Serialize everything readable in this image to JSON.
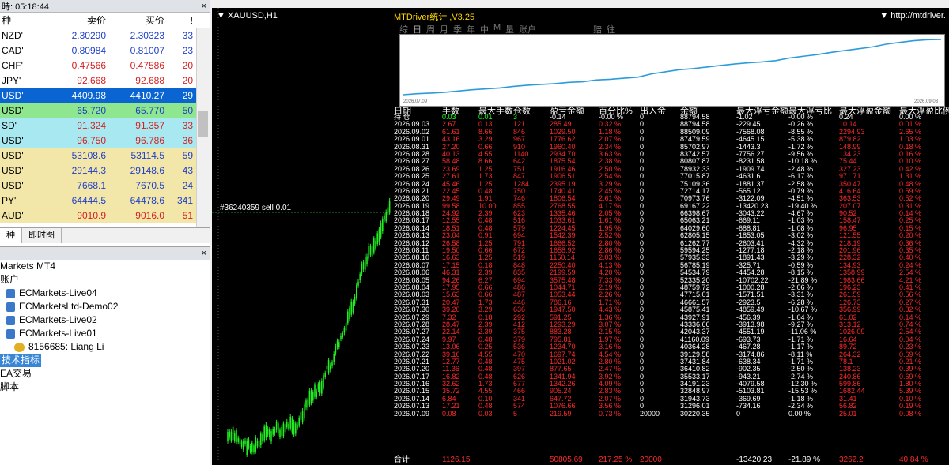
{
  "market_watch": {
    "time_label": "時: 05:18:44",
    "headers": [
      "种",
      "卖价",
      "买价",
      "!"
    ],
    "rows": [
      {
        "sym": "NZD'",
        "bid": "2.30290",
        "ask": "2.30323",
        "spread": "33",
        "bg": "#ffffff",
        "fg": "#1f3fc9"
      },
      {
        "sym": "CAD'",
        "bid": "0.80984",
        "ask": "0.81007",
        "spread": "23",
        "bg": "#ffffff",
        "fg": "#1f3fc9"
      },
      {
        "sym": "CHF'",
        "bid": "0.47566",
        "ask": "0.47586",
        "spread": "20",
        "bg": "#ffffff",
        "fg": "#d42020"
      },
      {
        "sym": "JPY'",
        "bid": "92.668",
        "ask": "92.688",
        "spread": "20",
        "bg": "#ffffff",
        "fg": "#d42020"
      },
      {
        "sym": "USD'",
        "bid": "4409.98",
        "ask": "4410.27",
        "spread": "29",
        "bg": "#0a64d2",
        "fg": "#ffffff"
      },
      {
        "sym": "USD'",
        "bid": "65.720",
        "ask": "65.770",
        "spread": "50",
        "bg": "#8ee68e",
        "fg": "#1f3fc9"
      },
      {
        "sym": "SD'",
        "bid": "91.324",
        "ask": "91.357",
        "spread": "33",
        "bg": "#a8e8f0",
        "fg": "#d42020"
      },
      {
        "sym": "USD'",
        "bid": "96.750",
        "ask": "96.786",
        "spread": "36",
        "bg": "#a8e8f0",
        "fg": "#d42020"
      },
      {
        "sym": "USD'",
        "bid": "53108.6",
        "ask": "53114.5",
        "spread": "59",
        "bg": "#f2e6a8",
        "fg": "#1f3fc9"
      },
      {
        "sym": "USD'",
        "bid": "29144.3",
        "ask": "29148.6",
        "spread": "43",
        "bg": "#f2e6a8",
        "fg": "#1f3fc9"
      },
      {
        "sym": "USD'",
        "bid": "7668.1",
        "ask": "7670.5",
        "spread": "24",
        "bg": "#f2e6a8",
        "fg": "#1f3fc9"
      },
      {
        "sym": "PY'",
        "bid": "64444.5",
        "ask": "64478.6",
        "spread": "341",
        "bg": "#f2e6a8",
        "fg": "#1f3fc9"
      },
      {
        "sym": "AUD'",
        "bid": "9010.9",
        "ask": "9016.0",
        "spread": "51",
        "bg": "#f2e6a8",
        "fg": "#d42020"
      }
    ],
    "tabs": [
      "种",
      "即时图"
    ]
  },
  "navigator": {
    "items": [
      {
        "text": "Markets MT4",
        "indent": 0,
        "icon": ""
      },
      {
        "text": "账户",
        "indent": 0,
        "icon": ""
      },
      {
        "text": "ECMarkets-Live04",
        "indent": 8,
        "icon": "server"
      },
      {
        "text": "ECMarketsLtd-Demo02",
        "indent": 8,
        "icon": "server"
      },
      {
        "text": "ECMarkets-Live02",
        "indent": 8,
        "icon": "server"
      },
      {
        "text": "ECMarkets-Live01",
        "indent": 8,
        "icon": "server"
      },
      {
        "text": "8156685: Liang Li",
        "indent": 18,
        "icon": "user"
      },
      {
        "text": "技术指标",
        "indent": 0,
        "icon": "",
        "selected": true
      },
      {
        "text": "EA交易",
        "indent": 0,
        "icon": ""
      },
      {
        "text": "脚本",
        "indent": 0,
        "icon": ""
      }
    ]
  },
  "chart": {
    "title": "XAUUSD,H1",
    "label": "#36240359 sell 0.01"
  },
  "panel": {
    "title": "MTDriver统计 ,V3.25",
    "url": "http://mtdriver.",
    "tabs": [
      "综",
      "日",
      "周",
      "月",
      "季",
      "年",
      "中",
      "M",
      "量",
      "账户",
      "",
      "赔",
      "往"
    ],
    "eq_start": "2026.07.09",
    "eq_end": "2026.09.03",
    "headers": [
      "日期",
      "手数",
      "最大手数",
      "仓数",
      "盈亏金额",
      "百分比%",
      "出入金",
      "余额",
      "最大浮亏金额",
      "最大浮亏比",
      "最大浮盈金额",
      "最大浮盈比例"
    ],
    "hold": {
      "date": "持 仓",
      "lots": "0.03",
      "maxlots": "0.01",
      "cnt": "3",
      "pnl": "-0.14",
      "pct": "-0.00 %",
      "io": "0",
      "bal": "88794.58",
      "fl": "-1.02",
      "flp": "-0.00 %",
      "fp": "0.24",
      "fpp": "0.00 %"
    },
    "rows": [
      [
        "2026.09.03",
        "2.67",
        "0.13",
        "121",
        "285.49",
        "0.32 %",
        "0",
        "88794.58",
        "-229.45",
        "-0.26 %",
        "10.14",
        "0.01 %"
      ],
      [
        "2026.09.02",
        "61.61",
        "8.66",
        "846",
        "1029.50",
        "1.18 %",
        "0",
        "88509.09",
        "-7568.08",
        "-8.55 %",
        "2294.93",
        "2.65 %"
      ],
      [
        "2026.09.01",
        "43.16",
        "3.29",
        "967",
        "1776.62",
        "2.07 %",
        "0",
        "87479.59",
        "-4645.15",
        "-5.38 %",
        "879.82",
        "1.03 %"
      ],
      [
        "2026.08.31",
        "27.20",
        "0.66",
        "910",
        "1960.40",
        "2.34 %",
        "0",
        "85702.97",
        "-1443.3",
        "-1.72 %",
        "148.99",
        "0.18 %"
      ],
      [
        "2026.08.28",
        "40.13",
        "4.55",
        "1140",
        "2934.70",
        "3.63 %",
        "0",
        "83742.57",
        "-7756.27",
        "-9.56 %",
        "134.23",
        "0.16 %"
      ],
      [
        "2026.08.27",
        "58.48",
        "8.66",
        "642",
        "1875.54",
        "2.38 %",
        "0",
        "80807.87",
        "-8231.58",
        "-10.18 %",
        "75.44",
        "0.10 %"
      ],
      [
        "2026.08.26",
        "23.69",
        "1.25",
        "751",
        "1916.46",
        "2.50 %",
        "0",
        "78932.33",
        "-1909.74",
        "-2.48 %",
        "327.23",
        "0.42 %"
      ],
      [
        "2026.08.25",
        "27.61",
        "1.73",
        "847",
        "1906.51",
        "2.54 %",
        "0",
        "77015.87",
        "-4631.6",
        "-6.17 %",
        "971.71",
        "1.31 %"
      ],
      [
        "2026.08.24",
        "45.46",
        "1.25",
        "1284",
        "2395.19",
        "3.29 %",
        "0",
        "75109.36",
        "-1881.37",
        "-2.58 %",
        "350.47",
        "0.48 %"
      ],
      [
        "2026.08.21",
        "22.45",
        "0.48",
        "750",
        "1740.41",
        "2.45 %",
        "0",
        "72714.17",
        "-565.12",
        "-0.79 %",
        "416.64",
        "0.59 %"
      ],
      [
        "2026.08.20",
        "29.49",
        "1.91",
        "746",
        "1806.54",
        "2.61 %",
        "0",
        "70973.76",
        "-3122.09",
        "-4.51 %",
        "363.53",
        "0.52 %"
      ],
      [
        "2026.08.19",
        "99.58",
        "10.00",
        "855",
        "2768.55",
        "4.17 %",
        "0",
        "69167.22",
        "-13420.23",
        "-19.40 %",
        "207.07",
        "0.31 %"
      ],
      [
        "2026.08.18",
        "24.92",
        "2.39",
        "623",
        "1335.46",
        "2.05 %",
        "0",
        "66398.67",
        "-3043.22",
        "-4.67 %",
        "90.52",
        "0.14 %"
      ],
      [
        "2026.08.17",
        "12.55",
        "0.48",
        "516",
        "1033.61",
        "1.61 %",
        "0",
        "65063.21",
        "-669.11",
        "-1.03 %",
        "158.47",
        "0.25 %"
      ],
      [
        "2026.08.14",
        "18.51",
        "0.48",
        "579",
        "1224.45",
        "1.95 %",
        "0",
        "64029.60",
        "-688.81",
        "-1.08 %",
        "96.95",
        "0.15 %"
      ],
      [
        "2026.08.13",
        "23.04",
        "0.91",
        "694",
        "1542.39",
        "2.52 %",
        "0",
        "62805.15",
        "-1853.05",
        "-3.02 %",
        "121.55",
        "0.20 %"
      ],
      [
        "2026.08.12",
        "26.58",
        "1.25",
        "791",
        "1666.52",
        "2.80 %",
        "0",
        "61262.77",
        "-2603.41",
        "-4.32 %",
        "218.19",
        "0.36 %"
      ],
      [
        "2026.08.11",
        "19.50",
        "0.66",
        "672",
        "1658.92",
        "2.86 %",
        "0",
        "59594.25",
        "-1277.18",
        "-2.18 %",
        "201.96",
        "0.35 %"
      ],
      [
        "2026.08.10",
        "16.63",
        "1.25",
        "519",
        "1150.14",
        "2.03 %",
        "0",
        "57935.33",
        "-1891.43",
        "-3.29 %",
        "228.32",
        "0.40 %"
      ],
      [
        "2026.08.07",
        "17.15",
        "0.18",
        "848",
        "2250.40",
        "4.13 %",
        "0",
        "56785.19",
        "-325.71",
        "-0.59 %",
        "134.93",
        "0.24 %"
      ],
      [
        "2026.08.06",
        "46.31",
        "2.39",
        "835",
        "2199.59",
        "4.20 %",
        "0",
        "54534.79",
        "-4454.28",
        "-8.15 %",
        "1358.99",
        "2.54 %"
      ],
      [
        "2026.08.05",
        "94.26",
        "6.27",
        "694",
        "3575.48",
        "7.33 %",
        "0",
        "52335.20",
        "-10702.22",
        "-21.89 %",
        "1983.66",
        "4.21 %"
      ],
      [
        "2026.08.04",
        "17.95",
        "0.66",
        "486",
        "1044.71",
        "2.19 %",
        "0",
        "48759.72",
        "-1000.28",
        "-2.06 %",
        "196.23",
        "0.41 %"
      ],
      [
        "2026.08.03",
        "15.63",
        "0.66",
        "487",
        "1053.44",
        "2.26 %",
        "0",
        "47715.01",
        "-1571.51",
        "-3.31 %",
        "261.59",
        "0.56 %"
      ],
      [
        "2026.07.31",
        "20.47",
        "1.73",
        "446",
        "786.16",
        "1.71 %",
        "0",
        "46661.57",
        "-2923.5",
        "-6.28 %",
        "126.73",
        "0.27 %"
      ],
      [
        "2026.07.30",
        "39.20",
        "3.29",
        "636",
        "1947.50",
        "4.43 %",
        "0",
        "45875.41",
        "-4859.49",
        "-10.67 %",
        "356.99",
        "0.82 %"
      ],
      [
        "2026.07.29",
        "7.32",
        "0.18",
        "292",
        "591.25",
        "1.36 %",
        "0",
        "43927.91",
        "-456.39",
        "-1.04 %",
        "61.02",
        "0.14 %"
      ],
      [
        "2026.07.28",
        "28.47",
        "2.39",
        "412",
        "1293.29",
        "3.07 %",
        "0",
        "43336.66",
        "-3913.98",
        "-9.27 %",
        "313.12",
        "0.74 %"
      ],
      [
        "2026.07.27",
        "22.14",
        "2.39",
        "375",
        "883.28",
        "2.15 %",
        "0",
        "42043.37",
        "-4551.19",
        "-11.06 %",
        "1026.09",
        "2.54 %"
      ],
      [
        "2026.07.24",
        "9.97",
        "0.48",
        "379",
        "795.81",
        "1.97 %",
        "0",
        "41160.09",
        "-693.73",
        "-1.71 %",
        "16.64",
        "0.04 %"
      ],
      [
        "2026.07.23",
        "13.06",
        "0.25",
        "536",
        "1234.70",
        "3.16 %",
        "0",
        "40364.28",
        "-467.28",
        "-1.17 %",
        "89.72",
        "0.23 %"
      ],
      [
        "2026.07.22",
        "39.16",
        "4.55",
        "470",
        "1697.74",
        "4.54 %",
        "0",
        "39129.58",
        "-3174.86",
        "-8.11 %",
        "264.32",
        "0.69 %"
      ],
      [
        "2026.07.21",
        "12.77",
        "0.48",
        "475",
        "1021.02",
        "2.80 %",
        "0",
        "37431.84",
        "-638.34",
        "-1.71 %",
        "78.1",
        "0.21 %"
      ],
      [
        "2026.07.20",
        "11.36",
        "0.48",
        "397",
        "877.65",
        "2.47 %",
        "0",
        "36410.82",
        "-902.35",
        "-2.50 %",
        "138.23",
        "0.39 %"
      ],
      [
        "2026.07.17",
        "16.82",
        "0.48",
        "626",
        "1341.94",
        "3.92 %",
        "0",
        "35533.17",
        "-943.21",
        "-2.74 %",
        "240.86",
        "0.69 %"
      ],
      [
        "2026.07.16",
        "32.62",
        "1.73",
        "677",
        "1342.26",
        "4.09 %",
        "0",
        "34191.23",
        "-4079.58",
        "-12.30 %",
        "599.86",
        "1.80 %"
      ],
      [
        "2026.07.15",
        "35.72",
        "4.55",
        "466",
        "905.24",
        "2.83 %",
        "0",
        "32848.97",
        "-5103.81",
        "-15.53 %",
        "1682.44",
        "5.39 %"
      ],
      [
        "2026.07.14",
        "6.84",
        "0.10",
        "341",
        "647.72",
        "2.07 %",
        "0",
        "31943.73",
        "-369.69",
        "-1.18 %",
        "31.41",
        "0.10 %"
      ],
      [
        "2026.07.13",
        "17.21",
        "0.48",
        "574",
        "1076.66",
        "3.56 %",
        "0",
        "31296.01",
        "-734.16",
        "-2.34 %",
        "56.82",
        "0.19 %"
      ],
      [
        "2026.07.09",
        "0.08",
        "0.03",
        "5",
        "219.59",
        "0.73 %",
        "20000",
        "30220.35",
        "0",
        "0.00 %",
        "25.01",
        "0.08 %"
      ]
    ],
    "total": {
      "label": "合计",
      "lots": "1126.15",
      "pnl": "50805.69",
      "pct": "217.25 %",
      "io": "20000",
      "fl": "-13420.23",
      "flp": "-21.89 %",
      "fp": "3262.2",
      "fpp": "40.84 %"
    }
  }
}
